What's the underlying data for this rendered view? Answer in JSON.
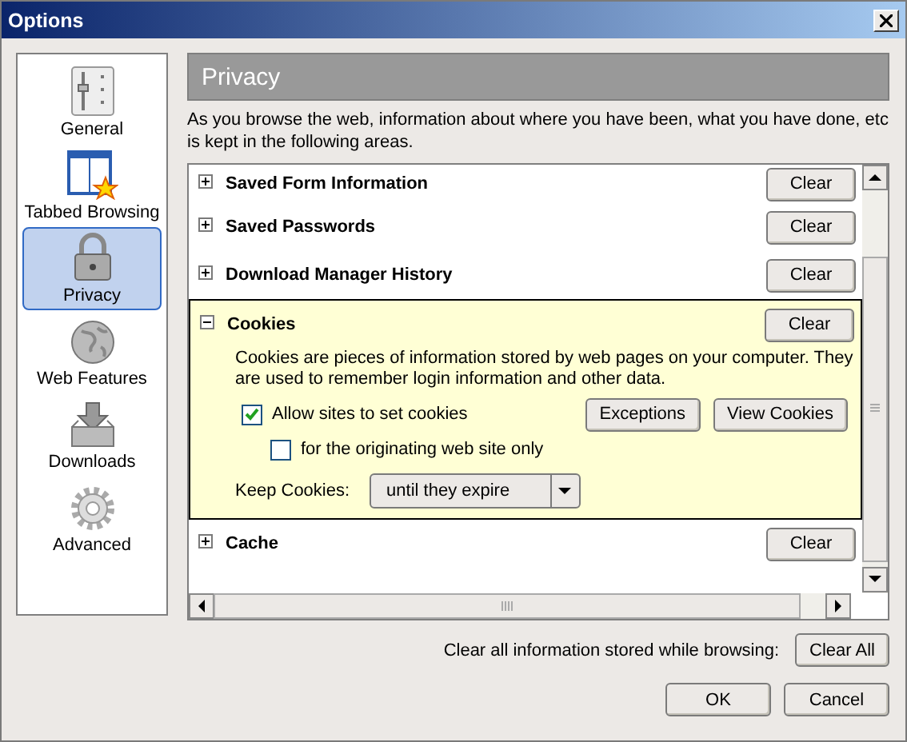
{
  "window": {
    "title": "Options"
  },
  "sidebar": {
    "items": [
      {
        "label": "General",
        "selected": false
      },
      {
        "label": "Tabbed Browsing",
        "selected": false
      },
      {
        "label": "Privacy",
        "selected": true
      },
      {
        "label": "Web Features",
        "selected": false
      },
      {
        "label": "Downloads",
        "selected": false
      },
      {
        "label": "Advanced",
        "selected": false
      }
    ]
  },
  "panel": {
    "title": "Privacy",
    "description": "As you browse the web, information about where you have been, what you have done, etc is kept in the following areas.",
    "items": [
      {
        "title": "Saved Form Information",
        "expanded": false,
        "button": "Clear"
      },
      {
        "title": "Saved Passwords",
        "expanded": false,
        "button": "Clear"
      },
      {
        "title": "Download Manager History",
        "expanded": false,
        "button": "Clear"
      },
      {
        "title": "Cookies",
        "expanded": true,
        "button": "Clear",
        "details": {
          "description": "Cookies are pieces of information stored by web pages on your computer. They are used to remember login information and other data.",
          "checkboxes": [
            {
              "label": "Allow sites to set cookies",
              "checked": true
            },
            {
              "label": "for the originating web site only",
              "checked": false
            }
          ],
          "buttons": [
            "Exceptions",
            "View Cookies"
          ],
          "keep_label": "Keep Cookies:",
          "keep_value": "until they expire"
        }
      },
      {
        "title": "Cache",
        "expanded": false,
        "button": "Clear"
      }
    ]
  },
  "footer": {
    "clear_all_label": "Clear all information stored while browsing:",
    "clear_all_button": "Clear All",
    "buttons": [
      "OK",
      "Cancel"
    ]
  }
}
